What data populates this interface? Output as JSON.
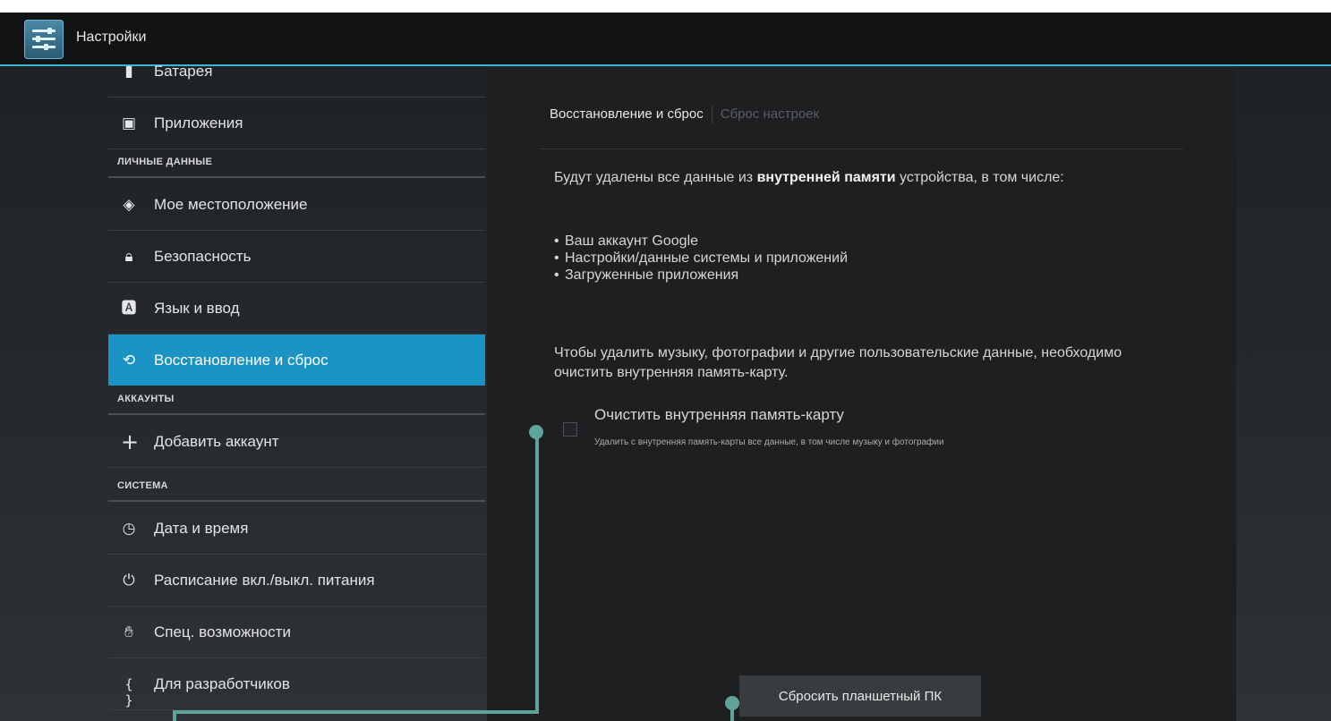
{
  "actionbar": {
    "title": "Настройки",
    "app_icon": "settings-icon"
  },
  "sidebar": {
    "items_top": [
      {
        "label": "Батарея",
        "icon": "battery-icon"
      },
      {
        "label": "Приложения",
        "icon": "apps-icon"
      }
    ],
    "section_personal": "ЛИЧНЫЕ ДАННЫЕ",
    "items_personal": [
      {
        "label": "Мое местоположение",
        "icon": "location-icon"
      },
      {
        "label": "Безопасность",
        "icon": "lock-icon"
      },
      {
        "label": "Язык и ввод",
        "icon": "language-icon"
      },
      {
        "label": "Восстановление и сброс",
        "icon": "restore-icon",
        "active": true
      }
    ],
    "section_accounts": "АККАУНТЫ",
    "add_account": {
      "label": "Добавить аккаунт",
      "icon": "plus-icon"
    },
    "section_system": "СИСТЕМА",
    "items_system": [
      {
        "label": "Дата и время",
        "icon": "clock-icon"
      },
      {
        "label": "Расписание вкл./выкл. питания",
        "icon": "power-schedule-icon"
      },
      {
        "label": "Спец. возможности",
        "icon": "hand-icon"
      },
      {
        "label": "Для разработчиков",
        "icon": "braces-icon"
      }
    ]
  },
  "panel": {
    "breadcrumb": {
      "current": "Восстановление и сброс",
      "sub": "Сброс настроек"
    },
    "warning": {
      "before": "Будут удалены все данные из ",
      "bold": "внутренней памяти",
      "after": " устройства, в том числе:"
    },
    "bullets": [
      "Ваш аккаунт Google",
      "Настройки/данные системы и приложений",
      "Загруженные приложения"
    ],
    "music_note": "Чтобы удалить музыку, фотографии и другие пользовательские данные, необходимо очистить внутренняя память-карту.",
    "erase_option": {
      "title": "Очистить внутренняя память-карту",
      "description": "Удалить с внутренняя память-карты все данные, в том числе музыку и фотографии",
      "checked": false
    },
    "reset_button": "Сбросить планшетный ПК"
  },
  "colors": {
    "accent": "#1b93c4",
    "actionbar_line": "#3cb6d6",
    "callout": "#5fa39b"
  }
}
